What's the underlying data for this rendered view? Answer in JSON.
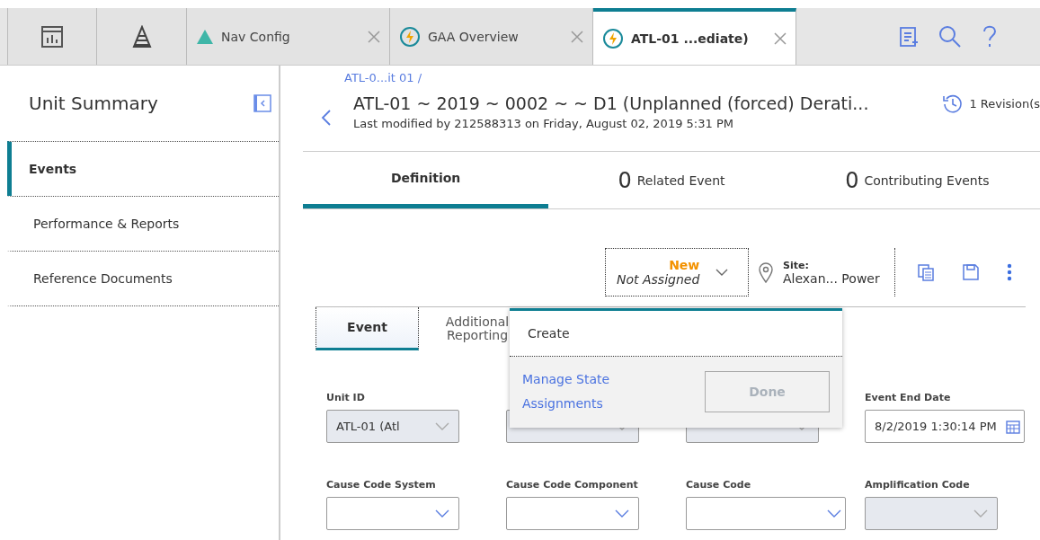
{
  "tabs": [
    {
      "kind": "dashboard",
      "selected": false
    },
    {
      "kind": "pyramid",
      "selected": false
    },
    {
      "kind": "nav",
      "label": "Nav Config",
      "selected": false
    },
    {
      "kind": "overview",
      "label": "GAA Overview",
      "selected": false
    },
    {
      "kind": "overview",
      "label": "ATL-01 ...ediate)",
      "selected": true
    }
  ],
  "sidebar": {
    "title": "Unit Summary",
    "items": [
      {
        "label": "Events",
        "selected": true
      },
      {
        "label": "Performance & Reports",
        "selected": false
      },
      {
        "label": "Reference Documents",
        "selected": false
      }
    ]
  },
  "header": {
    "breadcrumb": "ATL-0...it 01 /",
    "title": "ATL-01 ~ 2019 ~ 0002 ~ ~ D1 (Unplanned (forced) Derati...",
    "subtitle": "Last modified by 212588313 on Friday, August 02, 2019 5:31 PM",
    "revisions": "1 Revision(s"
  },
  "record_tabs": [
    {
      "label": "Definition",
      "selected": true
    },
    {
      "count": "0",
      "label": "Related Event",
      "selected": false
    },
    {
      "count": "0",
      "label": "Contributing Events",
      "selected": false
    }
  ],
  "state": {
    "status": "New",
    "assignee": "Not Assigned"
  },
  "site": {
    "label": "Site:",
    "value": "Alexan... Power"
  },
  "sub_tabs": [
    {
      "label": "Event",
      "selected": true
    },
    {
      "label": "Additional Reporting",
      "selected": false
    }
  ],
  "popup": {
    "action": "Create",
    "link": "Manage State Assignments",
    "button": "Done",
    "button_disabled": true
  },
  "fields": [
    {
      "label": "Unit ID",
      "value": "ATL-01 (Atl",
      "kind": "select",
      "disabled": true
    },
    {
      "kind": "select",
      "disabled": true
    },
    {
      "kind": "select",
      "disabled": true
    },
    {
      "label": "Event End Date",
      "value": "8/2/2019 1:30:14 PM",
      "kind": "date",
      "disabled": false
    },
    {
      "label": "Cause Code System",
      "kind": "select",
      "disabled": false
    },
    {
      "label": "Cause Code Component",
      "kind": "select",
      "disabled": false
    },
    {
      "label": "Cause Code",
      "kind": "select",
      "disabled": false
    },
    {
      "label": "Amplification Code",
      "kind": "select",
      "disabled": true
    }
  ]
}
